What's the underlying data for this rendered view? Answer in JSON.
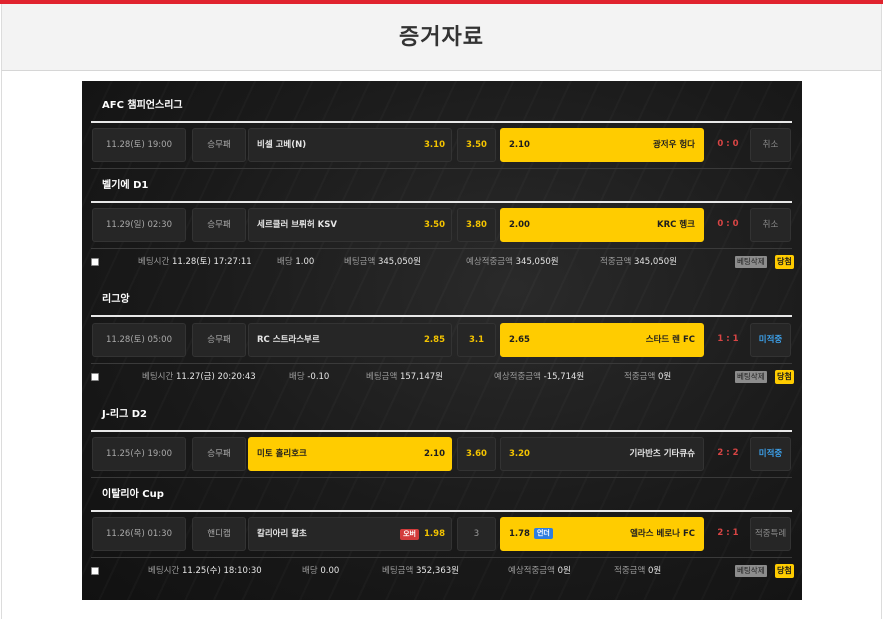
{
  "page": {
    "title": "증거자료"
  },
  "colors": {
    "accent": "#e0232e",
    "highlight": "#ffcc00",
    "score": "#d94545",
    "status_blue": "#3c9fe8"
  },
  "sections": [
    {
      "league": "AFC 챔피언스리그",
      "matches": [
        {
          "date": "11.28(토) 19:00",
          "type": "승무패",
          "home": "비셀 고베(N)",
          "home_odd": "3.10",
          "draw": "3.50",
          "away": "광저우 헝다",
          "away_odd": "2.10",
          "score": "0 : 0",
          "status": "취소"
        }
      ]
    },
    {
      "league": "벨기에 D1",
      "matches": [
        {
          "date": "11.29(일) 02:30",
          "type": "승무패",
          "home": "세르클러 브뤼허 KSV",
          "home_odd": "3.50",
          "draw": "3.80",
          "away": "KRC 헹크",
          "away_odd": "2.00",
          "score": "0 : 0",
          "status": "취소"
        }
      ],
      "bet": {
        "time_label": "베팅시간",
        "time": "11.28(토) 17:27:11",
        "odds_label": "배당",
        "odds": "1.00",
        "amount_label": "베팅금액",
        "amount": "345,050원",
        "expected_label": "예상적중금액",
        "expected": "345,050원",
        "win_label": "적중금액",
        "win": "345,050원",
        "delete": "베팅삭제",
        "result": "당첨"
      }
    },
    {
      "league": "리그앙",
      "matches": [
        {
          "date": "11.28(토) 05:00",
          "type": "승무패",
          "home": "RC 스트라스부르",
          "home_odd": "2.85",
          "draw": "3.1",
          "away": "스타드 렌 FC",
          "away_odd": "2.65",
          "score": "1 : 1",
          "status": "미적중"
        }
      ],
      "bet": {
        "time_label": "베팅시간",
        "time": "11.27(금) 20:20:43",
        "odds_label": "배당",
        "odds": "-0.10",
        "amount_label": "베팅금액",
        "amount": "157,147원",
        "expected_label": "예상적중금액",
        "expected": "-15,714원",
        "win_label": "적중금액",
        "win": "0원",
        "delete": "베팅삭제",
        "result": "당첨"
      }
    },
    {
      "league": "J-리그 D2",
      "matches": [
        {
          "date": "11.25(수) 19:00",
          "type": "승무패",
          "home": "미토 홀리호크",
          "home_odd": "2.10",
          "draw": "3.60",
          "away": "기타큐슈",
          "away_prefix": "기라반츠",
          "away_odd": "3.20",
          "score": "2 : 2",
          "status": "미적중"
        }
      ]
    },
    {
      "league": "이탈리아 Cup",
      "matches": [
        {
          "date": "11.26(목) 01:30",
          "type": "핸디캡",
          "home": "칼리아리 칼초",
          "home_tag": "오버",
          "home_odd": "1.98",
          "draw": "3",
          "away": "엘라스 베로나 FC",
          "away_tag": "언더",
          "away_odd": "1.78",
          "score": "2 : 1",
          "status": "적중특례"
        }
      ],
      "bet": {
        "time_label": "베팅시간",
        "time": "11.25(수) 18:10:30",
        "odds_label": "배당",
        "odds": "0.00",
        "amount_label": "베팅금액",
        "amount": "352,363원",
        "expected_label": "예상적중금액",
        "expected": "0원",
        "win_label": "적중금액",
        "win": "0원",
        "delete": "베팅삭제",
        "result": "당첨"
      }
    }
  ]
}
